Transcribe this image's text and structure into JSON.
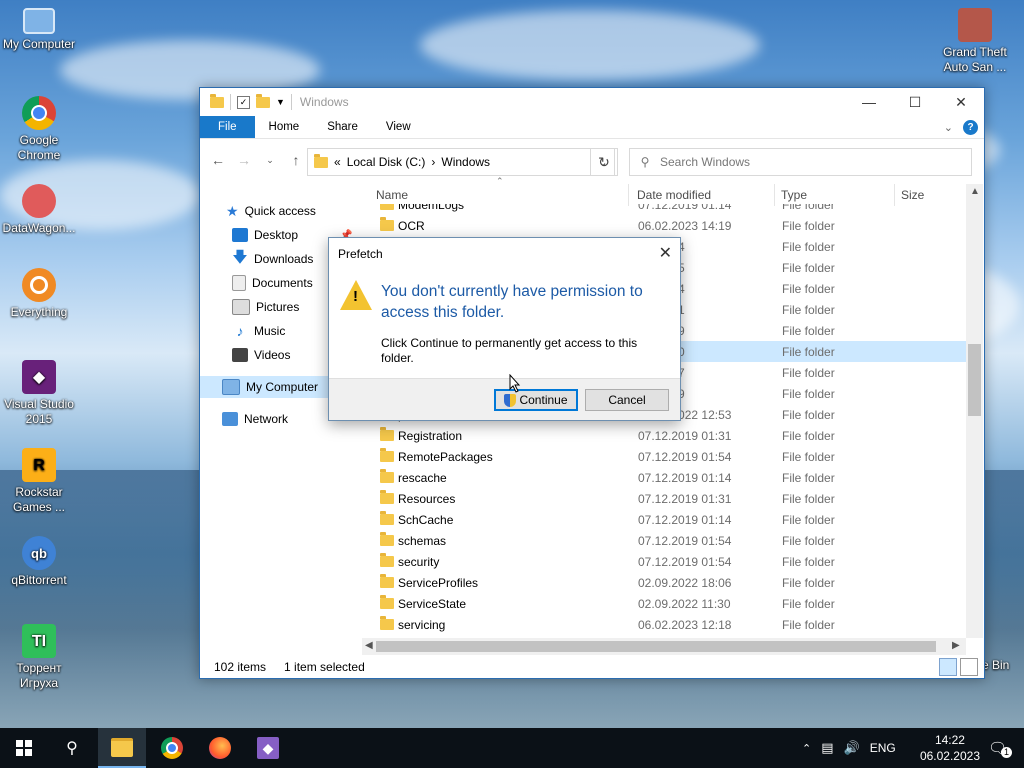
{
  "desktop": {
    "icons": [
      {
        "label": "My Computer",
        "icon": "computer-icon"
      },
      {
        "label": "Google Chrome",
        "icon": "chrome-icon"
      },
      {
        "label": "DataWagon...",
        "icon": "datawagon-icon"
      },
      {
        "label": "Everything",
        "icon": "everything-icon"
      },
      {
        "label": "Visual Studio 2015",
        "icon": "visual-studio-icon"
      },
      {
        "label": "Rockstar Games ...",
        "icon": "rockstar-icon"
      },
      {
        "label": "qBittorrent",
        "icon": "qbittorrent-icon"
      },
      {
        "label": "Торрент Игруха",
        "icon": "torrent-igruha-icon"
      },
      {
        "label": "Grand Theft Auto San ...",
        "icon": "gta-icon"
      }
    ],
    "recycle_bin_partial": "e Bin"
  },
  "explorer": {
    "title": "Windows",
    "ribbon": {
      "file": "File",
      "home": "Home",
      "share": "Share",
      "view": "View"
    },
    "address": {
      "prefix": "«",
      "drive": "Local Disk (C:)",
      "arrow": "›",
      "folder": "Windows"
    },
    "search_placeholder": "Search Windows",
    "nav": {
      "quick_access": "Quick access",
      "desktop": "Desktop",
      "downloads": "Downloads",
      "documents": "Documents",
      "pictures": "Pictures",
      "music": "Music",
      "videos": "Videos",
      "my_computer": "My Computer",
      "network": "Network"
    },
    "columns": {
      "name": "Name",
      "date": "Date modified",
      "type": "Type",
      "size": "Size"
    },
    "rows": [
      {
        "name": "ModemLogs",
        "date": "07.12.2019 01:14",
        "type": "File folder"
      },
      {
        "name": "OCR",
        "date": "06.02.2023 14:19",
        "type": "File folder"
      },
      {
        "name": "",
        "date": "19 01:14",
        "type": "File folder"
      },
      {
        "name": "",
        "date": "22 02:05",
        "type": "File folder"
      },
      {
        "name": "",
        "date": "19 01:14",
        "type": "File folder"
      },
      {
        "name": "",
        "date": "19 01:31",
        "type": "File folder"
      },
      {
        "name": "",
        "date": "22 02:19",
        "type": "File folder"
      },
      {
        "name": "",
        "date": "23 14:20",
        "type": "File folder"
      },
      {
        "name": "",
        "date": "22 21:37",
        "type": "File folder"
      },
      {
        "name": "",
        "date": "22 02:19",
        "type": "File folder"
      },
      {
        "name": "pss",
        "date": "02.09.2022 12:53",
        "type": "File folder"
      },
      {
        "name": "Registration",
        "date": "07.12.2019 01:31",
        "type": "File folder"
      },
      {
        "name": "RemotePackages",
        "date": "07.12.2019 01:54",
        "type": "File folder"
      },
      {
        "name": "rescache",
        "date": "07.12.2019 01:14",
        "type": "File folder"
      },
      {
        "name": "Resources",
        "date": "07.12.2019 01:31",
        "type": "File folder"
      },
      {
        "name": "SchCache",
        "date": "07.12.2019 01:14",
        "type": "File folder"
      },
      {
        "name": "schemas",
        "date": "07.12.2019 01:54",
        "type": "File folder"
      },
      {
        "name": "security",
        "date": "07.12.2019 01:54",
        "type": "File folder"
      },
      {
        "name": "ServiceProfiles",
        "date": "02.09.2022 18:06",
        "type": "File folder"
      },
      {
        "name": "ServiceState",
        "date": "02.09.2022 11:30",
        "type": "File folder"
      },
      {
        "name": "servicing",
        "date": "06.02.2023 12:18",
        "type": "File folder"
      }
    ],
    "selected_row": 7,
    "status": {
      "items": "102 items",
      "selected": "1 item selected"
    }
  },
  "dialog": {
    "title": "Prefetch",
    "main": "You don't currently have permission to access this folder.",
    "sub": "Click Continue to permanently get access to this folder.",
    "continue": "Continue",
    "cancel": "Cancel"
  },
  "taskbar": {
    "lang": "ENG",
    "time": "14:22",
    "date": "06.02.2023",
    "notifications": "1",
    "apps": [
      "file-explorer-icon",
      "chrome-icon",
      "firefox-icon",
      "visual-studio-icon"
    ]
  },
  "colors": {
    "accent": "#1979ca",
    "dialog_heading": "#1c5aa6",
    "selection": "#cce8ff"
  }
}
